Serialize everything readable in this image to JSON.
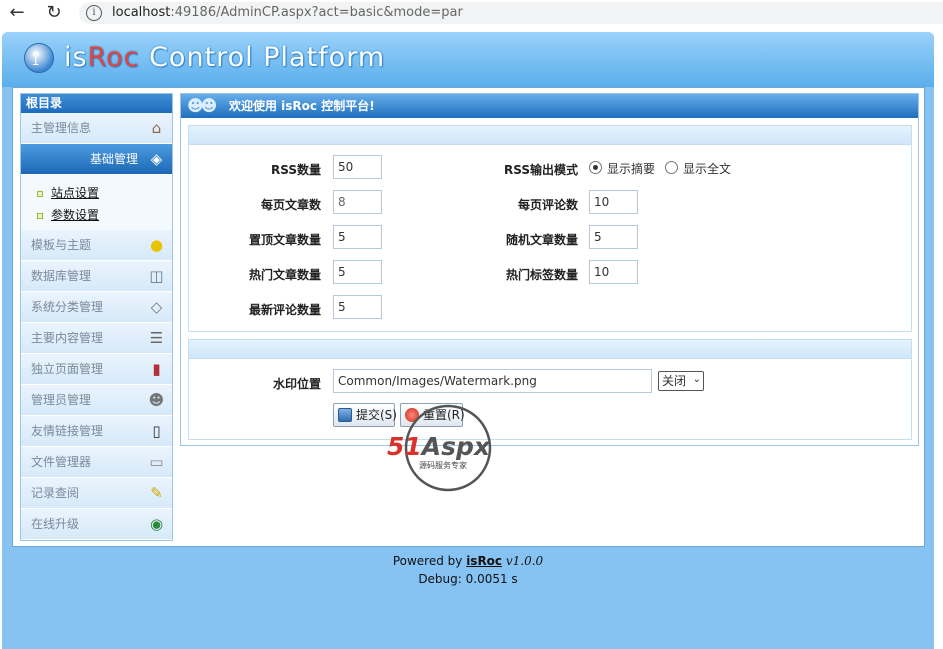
{
  "browser": {
    "url_host": "localhost",
    "url_rest": ":49186/AdminCP.aspx?act=basic&mode=par"
  },
  "header": {
    "brand_prefix": "is",
    "brand_accent": "Roc",
    "brand_suffix": " Control Platform"
  },
  "sidebar": {
    "title": "根目录",
    "items": [
      {
        "label": "主管理信息",
        "icon": "house-icon"
      },
      {
        "label": "基础管理",
        "icon": "cube-icon",
        "active": true
      },
      {
        "label": "模板与主题",
        "icon": "bulb-icon"
      },
      {
        "label": "数据库管理",
        "icon": "database-icon"
      },
      {
        "label": "系统分类管理",
        "icon": "tag-icon"
      },
      {
        "label": "主要内容管理",
        "icon": "book-icon"
      },
      {
        "label": "独立页面管理",
        "icon": "books-icon"
      },
      {
        "label": "管理员管理",
        "icon": "users-icon"
      },
      {
        "label": "友情链接管理",
        "icon": "battery-icon"
      },
      {
        "label": "文件管理器",
        "icon": "disk-icon"
      },
      {
        "label": "记录查阅",
        "icon": "pencil-icon"
      },
      {
        "label": "在线升级",
        "icon": "globe-icon"
      }
    ],
    "sub_items": [
      "站点设置",
      "参数设置"
    ]
  },
  "content": {
    "title": "欢迎使用 isRoc 控制平台!",
    "fields": {
      "rss_count_label": "RSS数量",
      "rss_count_value": "50",
      "per_page_articles_label": "每页文章数",
      "per_page_articles_value": "8",
      "top_articles_label": "置顶文章数量",
      "top_articles_value": "5",
      "hot_articles_label": "热门文章数量",
      "hot_articles_value": "5",
      "latest_comments_label": "最新评论数量",
      "latest_comments_value": "5",
      "rss_mode_label": "RSS输出模式",
      "rss_mode_option_summary": "显示摘要",
      "rss_mode_option_full": "显示全文",
      "per_page_comments_label": "每页评论数",
      "per_page_comments_value": "10",
      "random_articles_label": "随机文章数量",
      "random_articles_value": "5",
      "hot_tags_label": "热门标签数量",
      "hot_tags_value": "10"
    },
    "watermark": {
      "label": "水印位置",
      "path_value": "Common/Images/Watermark.png",
      "select_value": "关闭"
    },
    "buttons": {
      "submit": "提交(S)",
      "reset": "重置(R)"
    }
  },
  "stamp": {
    "main": "51Aspx",
    "sub": "源码服务专家"
  },
  "footer": {
    "powered_by": "Powered by ",
    "brand": "isRoc",
    "version": " v1.0.0",
    "debug": "Debug: 0.0051 s"
  },
  "colors": {
    "accent_blue": "#1e6cbd",
    "frame_blue": "#86c3f3",
    "brand_red": "#e8423a"
  }
}
